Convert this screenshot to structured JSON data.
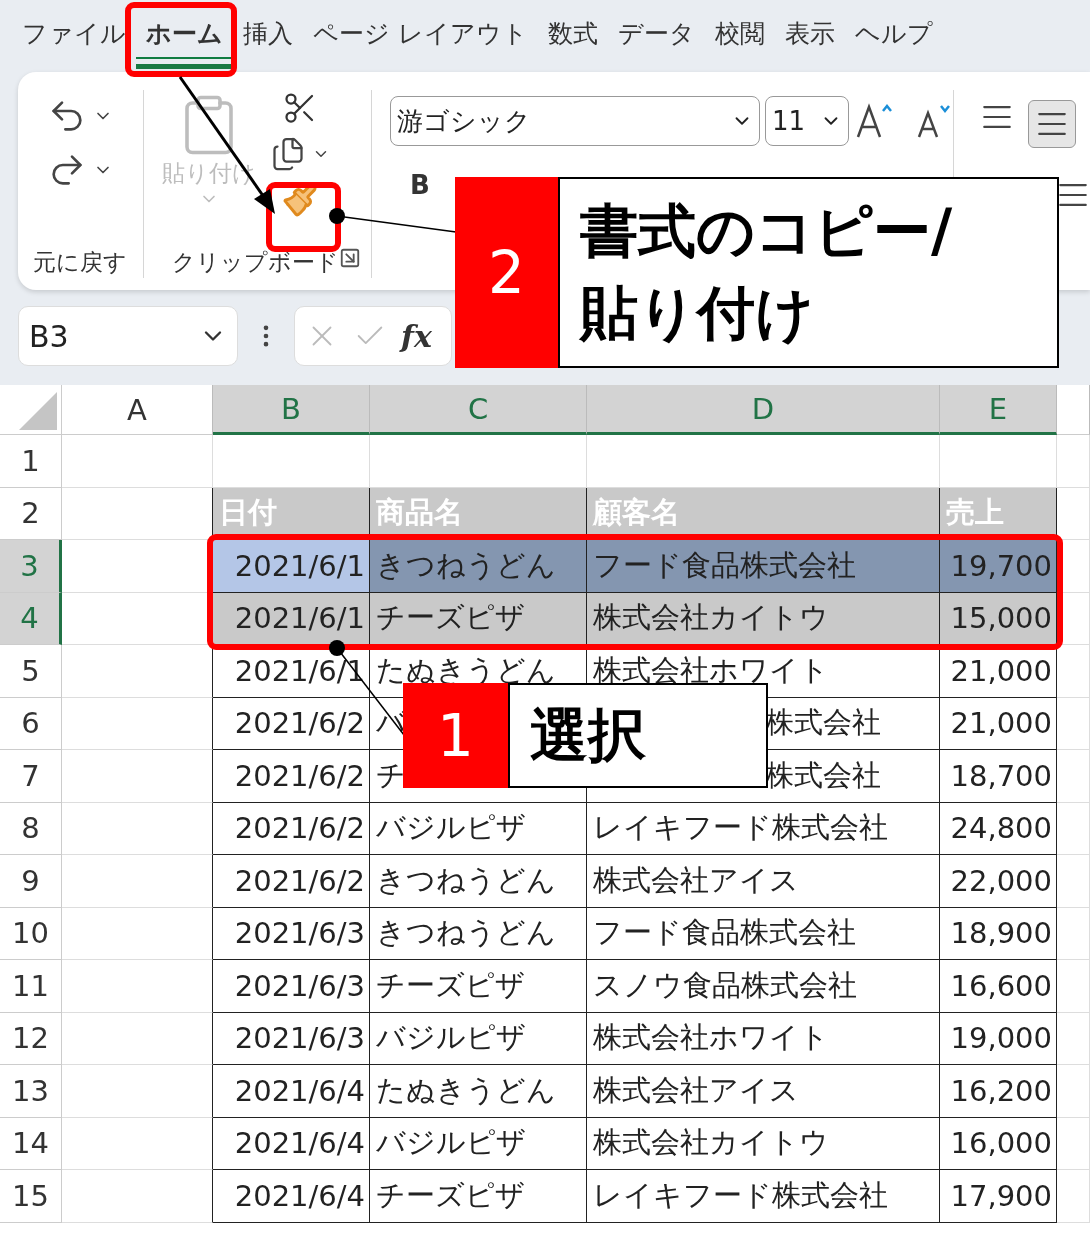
{
  "tabs": [
    {
      "label": "ファイル",
      "selected": false
    },
    {
      "label": "ホーム",
      "selected": true
    },
    {
      "label": "挿入",
      "selected": false
    },
    {
      "label": "ページ レイアウト",
      "selected": false
    },
    {
      "label": "数式",
      "selected": false
    },
    {
      "label": "データ",
      "selected": false
    },
    {
      "label": "校閲",
      "selected": false
    },
    {
      "label": "表示",
      "selected": false
    },
    {
      "label": "ヘルプ",
      "selected": false
    }
  ],
  "ribbon": {
    "undo_group": "元に戻す",
    "clipboard_group": "クリップボード",
    "paste": "貼り付け",
    "font_name": "游ゴシック",
    "font_size": "11",
    "bold": "B"
  },
  "formula_bar": {
    "name_box": "B3",
    "function_label": "fx"
  },
  "columns": [
    {
      "label": "A",
      "selected": false
    },
    {
      "label": "B",
      "selected": true
    },
    {
      "label": "C",
      "selected": true
    },
    {
      "label": "D",
      "selected": true
    },
    {
      "label": "E",
      "selected": true
    }
  ],
  "rows": [
    {
      "number": "1",
      "kind": "blank",
      "selected": false,
      "active": false
    },
    {
      "number": "2",
      "kind": "header",
      "selected": false,
      "active": false,
      "color": "#c9c9c9",
      "cells": [
        {
          "text": "日付"
        },
        {
          "text": "商品名"
        },
        {
          "text": "顧客名"
        },
        {
          "text": "売上"
        }
      ]
    },
    {
      "number": "3",
      "kind": "data",
      "selected": true,
      "active": true,
      "color": "#8496b0",
      "cells": [
        {
          "text": "2021/6/1"
        },
        {
          "text": "きつねうどん"
        },
        {
          "text": "フード食品株式会社"
        },
        {
          "text": "19,700"
        }
      ]
    },
    {
      "number": "4",
      "kind": "data",
      "selected": true,
      "active": false,
      "color": "#c9c9c9",
      "cells": [
        {
          "text": "2021/6/1"
        },
        {
          "text": "チーズピザ"
        },
        {
          "text": "株式会社カイトウ"
        },
        {
          "text": "15,000"
        }
      ]
    },
    {
      "number": "5",
      "kind": "data",
      "selected": false,
      "active": false,
      "cells": [
        {
          "text": "2021/6/1"
        },
        {
          "text": "たぬきうどん"
        },
        {
          "text": "株式会社ホワイト"
        },
        {
          "text": "21,000"
        }
      ]
    },
    {
      "number": "6",
      "kind": "data",
      "selected": false,
      "active": false,
      "cells": [
        {
          "text": "2021/6/2"
        },
        {
          "text": "バ"
        },
        {
          "text": "株式会社",
          "covered": true
        },
        {
          "text": "21,000"
        }
      ]
    },
    {
      "number": "7",
      "kind": "data",
      "selected": false,
      "active": false,
      "cells": [
        {
          "text": "2021/6/2"
        },
        {
          "text": "チ"
        },
        {
          "text": "株式会社",
          "covered": true
        },
        {
          "text": "18,700"
        }
      ]
    },
    {
      "number": "8",
      "kind": "data",
      "selected": false,
      "active": false,
      "cells": [
        {
          "text": "2021/6/2"
        },
        {
          "text": "バジルピザ"
        },
        {
          "text": "レイキフード株式会社"
        },
        {
          "text": "24,800"
        }
      ]
    },
    {
      "number": "9",
      "kind": "data",
      "selected": false,
      "active": false,
      "cells": [
        {
          "text": "2021/6/2"
        },
        {
          "text": "きつねうどん"
        },
        {
          "text": "株式会社アイス"
        },
        {
          "text": "22,000"
        }
      ]
    },
    {
      "number": "10",
      "kind": "data",
      "selected": false,
      "active": false,
      "cells": [
        {
          "text": "2021/6/3"
        },
        {
          "text": "きつねうどん"
        },
        {
          "text": "フード食品株式会社"
        },
        {
          "text": "18,900"
        }
      ]
    },
    {
      "number": "11",
      "kind": "data",
      "selected": false,
      "active": false,
      "cells": [
        {
          "text": "2021/6/3"
        },
        {
          "text": "チーズピザ"
        },
        {
          "text": "スノウ食品株式会社"
        },
        {
          "text": "16,600"
        }
      ]
    },
    {
      "number": "12",
      "kind": "data",
      "selected": false,
      "active": false,
      "cells": [
        {
          "text": "2021/6/3"
        },
        {
          "text": "バジルピザ"
        },
        {
          "text": "株式会社ホワイト"
        },
        {
          "text": "19,000"
        }
      ]
    },
    {
      "number": "13",
      "kind": "data",
      "selected": false,
      "active": false,
      "cells": [
        {
          "text": "2021/6/4"
        },
        {
          "text": "たぬきうどん"
        },
        {
          "text": "株式会社アイス"
        },
        {
          "text": "16,200"
        }
      ]
    },
    {
      "number": "14",
      "kind": "data",
      "selected": false,
      "active": false,
      "cells": [
        {
          "text": "2021/6/4"
        },
        {
          "text": "バジルピザ"
        },
        {
          "text": "株式会社カイトウ"
        },
        {
          "text": "16,000"
        }
      ]
    },
    {
      "number": "15",
      "kind": "data",
      "selected": false,
      "active": false,
      "cells": [
        {
          "text": "2021/6/4"
        },
        {
          "text": "チーズピザ"
        },
        {
          "text": "レイキフード株式会社"
        },
        {
          "text": "17,900"
        }
      ]
    }
  ],
  "callouts": [
    {
      "number": "2",
      "text": "書式のコピー/\n貼り付け",
      "kind": "painter"
    },
    {
      "number": "1",
      "text": "選択",
      "kind": "selection"
    }
  ]
}
